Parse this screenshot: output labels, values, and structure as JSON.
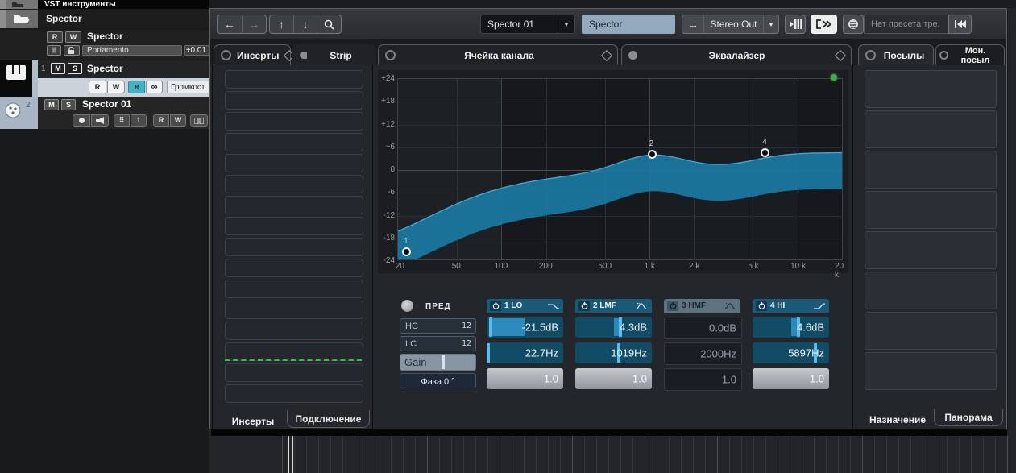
{
  "toolbar": {
    "back": "←",
    "forward": "→",
    "up": "↑",
    "down": "↓",
    "channel_selector": "Spector 01",
    "channel_name": "Spector",
    "output_arrow": "→",
    "output_bus": "Stereo Out",
    "preset_field": "Нет пресета тре."
  },
  "tabs": {
    "inserts": "Инсерты",
    "strip": "Strip",
    "channel_cell": "Ячейка канала",
    "equalizer": "Эквалайзер",
    "sends": "Посылы",
    "mon_send": "Мон. посыл"
  },
  "bottom_tabs": {
    "inserts": "Инсерты",
    "routing": "Подключение",
    "destination": "Назначение",
    "panorama": "Панорама"
  },
  "tracks": {
    "folder1": "VST инструменты",
    "folder2": "Spector",
    "automation": {
      "r": "R",
      "w": "W",
      "title": "Spector",
      "param": "Portamento",
      "value": "+0.01"
    },
    "track1": {
      "num": "1",
      "m": "M",
      "s": "S",
      "title": "Spector",
      "r": "R",
      "w": "W",
      "e": "e",
      "link": "∞",
      "volume": "Громкост"
    },
    "track2": {
      "num": "2",
      "m": "M",
      "s": "S",
      "title": "Spector 01",
      "midi_ch": "1",
      "r": "R",
      "w": "W"
    }
  },
  "eq": {
    "pre": {
      "label": "ПРЕД",
      "hc": "HC",
      "hc_slope": "12",
      "lc": "LC",
      "lc_slope": "12",
      "gain": "Gain",
      "gain_handle_pct": 55,
      "phase": "Фаза 0 °"
    },
    "bands": [
      {
        "name": "1 LO",
        "type": "low-shelf",
        "enabled": true,
        "gain_db": -21.5,
        "freq_hz": 22.7,
        "q": 1.0,
        "gain_label": "-21.5dB",
        "freq_label": "22.7Hz",
        "q_label": "1.0"
      },
      {
        "name": "2 LMF",
        "type": "peak",
        "enabled": true,
        "gain_db": 4.3,
        "freq_hz": 1019,
        "q": 1.0,
        "gain_label": "4.3dB",
        "freq_label": "1019Hz",
        "q_label": "1.0"
      },
      {
        "name": "3 HMF",
        "type": "peak",
        "enabled": false,
        "gain_db": 0.0,
        "freq_hz": 2000,
        "q": 1.0,
        "gain_label": "0.0dB",
        "freq_label": "2000Hz",
        "q_label": "1.0"
      },
      {
        "name": "4 HI",
        "type": "high-shelf",
        "enabled": true,
        "gain_db": 4.6,
        "freq_hz": 5897,
        "q": 1.0,
        "gain_label": "4.6dB",
        "freq_label": "5897Hz",
        "q_label": "1.0"
      }
    ]
  },
  "chart_data": {
    "type": "line",
    "title": "Эквалайзер",
    "x_scale": "log",
    "x_range_hz": [
      20,
      20000
    ],
    "ylim": [
      -24,
      24
    ],
    "x_ticks": [
      "20",
      "50",
      "100",
      "200",
      "500",
      "1 k",
      "2 k",
      "5 k",
      "10 k",
      "20 k"
    ],
    "y_ticks": [
      "+24",
      "+18",
      "+12",
      "+6",
      "0",
      "-6",
      "-12",
      "-18",
      "-24"
    ],
    "grid": true,
    "points": [
      {
        "label": "1",
        "freq_hz": 22.7,
        "gain_db": -21.5
      },
      {
        "label": "2",
        "freq_hz": 1019,
        "gain_db": 4.3
      },
      {
        "label": "4",
        "freq_hz": 5897,
        "gain_db": 4.6
      }
    ],
    "accent_fill": "#1b7aa3",
    "accent_stroke": "#3fa6d4"
  },
  "panels": {
    "insert_slot_count": 16,
    "send_slot_count": 8
  },
  "colors": {
    "eq_enabled": "#15506e",
    "eq_fill": "#2b89bc",
    "eq_handle": "#5cbcf0",
    "green_indicator": "#3fae46"
  }
}
